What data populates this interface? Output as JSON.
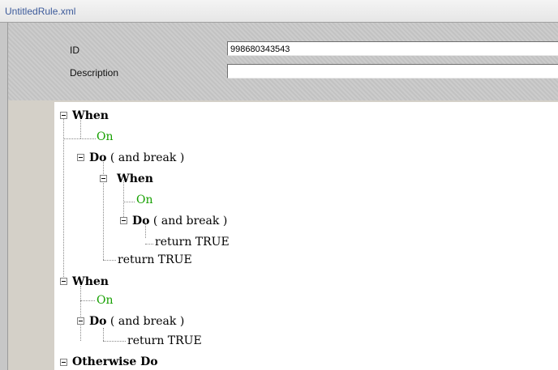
{
  "window": {
    "title": "UntitledRule.xml"
  },
  "form": {
    "id_label": "ID",
    "id_value": "998680343543",
    "description_label": "Description",
    "description_value": ""
  },
  "tree": {
    "when1": "When",
    "on1": "On",
    "do1": "Do",
    "do1_suffix": " ( and break )",
    "when2": "When",
    "on2": "On",
    "do2": "Do",
    "do2_suffix": " ( and break )",
    "ret1": "return TRUE",
    "ret2": "return TRUE",
    "when3": "When",
    "on3": "On",
    "do3": "Do",
    "do3_suffix": " ( and break )",
    "ret3": "return TRUE",
    "otherwise": "Otherwise Do"
  },
  "colors": {
    "on_text": "#16a000",
    "title_text": "#3c5a9a"
  }
}
